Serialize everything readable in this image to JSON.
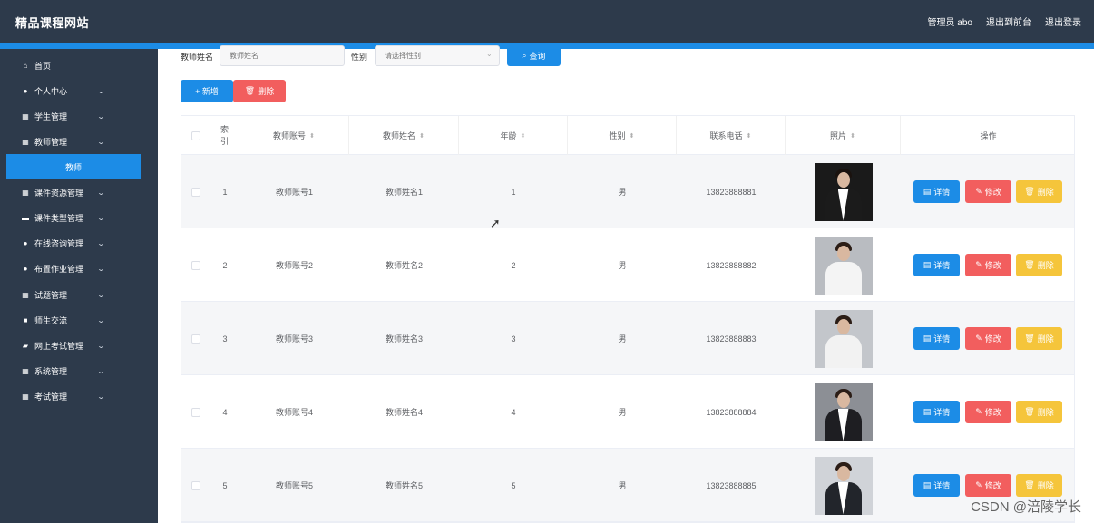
{
  "header": {
    "brand": "精品课程网站",
    "admin": "管理员 abo",
    "to_front": "退出到前台",
    "logout": "退出登录"
  },
  "sidebar": {
    "items": [
      {
        "label": "首页",
        "icon": "home-icon",
        "glyph": "⌂",
        "expandable": false
      },
      {
        "label": "个人中心",
        "icon": "user-icon",
        "glyph": "●",
        "expandable": true
      },
      {
        "label": "学生管理",
        "icon": "grid-icon",
        "glyph": "▦",
        "expandable": true
      },
      {
        "label": "教师管理",
        "icon": "grid-icon",
        "glyph": "▦",
        "expandable": true
      },
      {
        "label": "课件资源管理",
        "icon": "grid-icon",
        "glyph": "▦",
        "expandable": true
      },
      {
        "label": "课件类型管理",
        "icon": "ticket-icon",
        "glyph": "▬",
        "expandable": true
      },
      {
        "label": "在线咨询管理",
        "icon": "location-icon",
        "glyph": "●",
        "expandable": true
      },
      {
        "label": "布置作业管理",
        "icon": "user-icon",
        "glyph": "●",
        "expandable": true
      },
      {
        "label": "试题管理",
        "icon": "grid-icon",
        "glyph": "▦",
        "expandable": true
      },
      {
        "label": "师生交流",
        "icon": "chat-icon",
        "glyph": "■",
        "expandable": true
      },
      {
        "label": "网上考试管理",
        "icon": "briefcase-icon",
        "glyph": "▰",
        "expandable": true
      },
      {
        "label": "系统管理",
        "icon": "grid-icon",
        "glyph": "▦",
        "expandable": true
      },
      {
        "label": "考试管理",
        "icon": "table-icon",
        "glyph": "▦",
        "expandable": true
      }
    ],
    "active_sub": "教师",
    "chevron": "⌄"
  },
  "search": {
    "name_label": "教师姓名",
    "name_placeholder": "教师姓名",
    "gender_label": "性别",
    "gender_placeholder": "请选择性别",
    "query_button": "查询"
  },
  "toolbar": {
    "add_button": "+ 新增",
    "delete_button": "删除"
  },
  "table": {
    "headers": {
      "index": "索引",
      "account": "教师账号",
      "name": "教师姓名",
      "age": "年龄",
      "gender": "性别",
      "phone": "联系电话",
      "photo": "照片",
      "actions": "操作"
    },
    "rows": [
      {
        "index": "1",
        "account": "教师账号1",
        "name": "教师姓名1",
        "age": "1",
        "gender": "男",
        "phone": "13823888881"
      },
      {
        "index": "2",
        "account": "教师账号2",
        "name": "教师姓名2",
        "age": "2",
        "gender": "男",
        "phone": "13823888882"
      },
      {
        "index": "3",
        "account": "教师账号3",
        "name": "教师姓名3",
        "age": "3",
        "gender": "男",
        "phone": "13823888883"
      },
      {
        "index": "4",
        "account": "教师账号4",
        "name": "教师姓名4",
        "age": "4",
        "gender": "男",
        "phone": "13823888884"
      },
      {
        "index": "5",
        "account": "教师账号5",
        "name": "教师姓名5",
        "age": "5",
        "gender": "男",
        "phone": "13823888885"
      }
    ],
    "detail_label": "详情",
    "edit_label": "修改",
    "delete_label": "删除"
  },
  "watermark": "CSDN @涪陵学长",
  "colors": {
    "nav_bg": "#2d3a4b",
    "accent": "#1c8ce6",
    "danger": "#f25e5e",
    "warning": "#f5c53b"
  }
}
